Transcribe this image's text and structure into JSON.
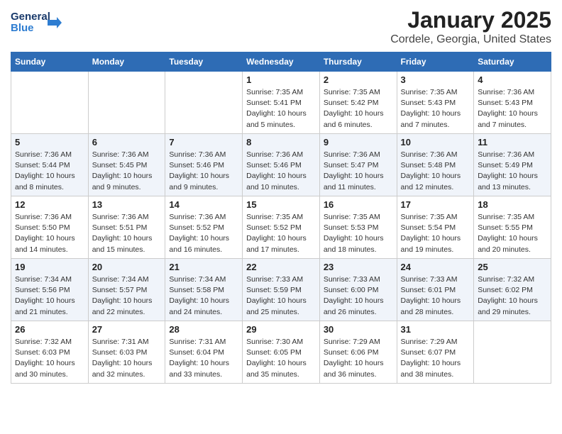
{
  "logo": {
    "line1": "General",
    "line2": "Blue"
  },
  "title": "January 2025",
  "subtitle": "Cordele, Georgia, United States",
  "days_of_week": [
    "Sunday",
    "Monday",
    "Tuesday",
    "Wednesday",
    "Thursday",
    "Friday",
    "Saturday"
  ],
  "weeks": [
    {
      "days": [
        {
          "num": "",
          "info": ""
        },
        {
          "num": "",
          "info": ""
        },
        {
          "num": "",
          "info": ""
        },
        {
          "num": "1",
          "info": "Sunrise: 7:35 AM\nSunset: 5:41 PM\nDaylight: 10 hours\nand 5 minutes."
        },
        {
          "num": "2",
          "info": "Sunrise: 7:35 AM\nSunset: 5:42 PM\nDaylight: 10 hours\nand 6 minutes."
        },
        {
          "num": "3",
          "info": "Sunrise: 7:35 AM\nSunset: 5:43 PM\nDaylight: 10 hours\nand 7 minutes."
        },
        {
          "num": "4",
          "info": "Sunrise: 7:36 AM\nSunset: 5:43 PM\nDaylight: 10 hours\nand 7 minutes."
        }
      ]
    },
    {
      "days": [
        {
          "num": "5",
          "info": "Sunrise: 7:36 AM\nSunset: 5:44 PM\nDaylight: 10 hours\nand 8 minutes."
        },
        {
          "num": "6",
          "info": "Sunrise: 7:36 AM\nSunset: 5:45 PM\nDaylight: 10 hours\nand 9 minutes."
        },
        {
          "num": "7",
          "info": "Sunrise: 7:36 AM\nSunset: 5:46 PM\nDaylight: 10 hours\nand 9 minutes."
        },
        {
          "num": "8",
          "info": "Sunrise: 7:36 AM\nSunset: 5:46 PM\nDaylight: 10 hours\nand 10 minutes."
        },
        {
          "num": "9",
          "info": "Sunrise: 7:36 AM\nSunset: 5:47 PM\nDaylight: 10 hours\nand 11 minutes."
        },
        {
          "num": "10",
          "info": "Sunrise: 7:36 AM\nSunset: 5:48 PM\nDaylight: 10 hours\nand 12 minutes."
        },
        {
          "num": "11",
          "info": "Sunrise: 7:36 AM\nSunset: 5:49 PM\nDaylight: 10 hours\nand 13 minutes."
        }
      ]
    },
    {
      "days": [
        {
          "num": "12",
          "info": "Sunrise: 7:36 AM\nSunset: 5:50 PM\nDaylight: 10 hours\nand 14 minutes."
        },
        {
          "num": "13",
          "info": "Sunrise: 7:36 AM\nSunset: 5:51 PM\nDaylight: 10 hours\nand 15 minutes."
        },
        {
          "num": "14",
          "info": "Sunrise: 7:36 AM\nSunset: 5:52 PM\nDaylight: 10 hours\nand 16 minutes."
        },
        {
          "num": "15",
          "info": "Sunrise: 7:35 AM\nSunset: 5:52 PM\nDaylight: 10 hours\nand 17 minutes."
        },
        {
          "num": "16",
          "info": "Sunrise: 7:35 AM\nSunset: 5:53 PM\nDaylight: 10 hours\nand 18 minutes."
        },
        {
          "num": "17",
          "info": "Sunrise: 7:35 AM\nSunset: 5:54 PM\nDaylight: 10 hours\nand 19 minutes."
        },
        {
          "num": "18",
          "info": "Sunrise: 7:35 AM\nSunset: 5:55 PM\nDaylight: 10 hours\nand 20 minutes."
        }
      ]
    },
    {
      "days": [
        {
          "num": "19",
          "info": "Sunrise: 7:34 AM\nSunset: 5:56 PM\nDaylight: 10 hours\nand 21 minutes."
        },
        {
          "num": "20",
          "info": "Sunrise: 7:34 AM\nSunset: 5:57 PM\nDaylight: 10 hours\nand 22 minutes."
        },
        {
          "num": "21",
          "info": "Sunrise: 7:34 AM\nSunset: 5:58 PM\nDaylight: 10 hours\nand 24 minutes."
        },
        {
          "num": "22",
          "info": "Sunrise: 7:33 AM\nSunset: 5:59 PM\nDaylight: 10 hours\nand 25 minutes."
        },
        {
          "num": "23",
          "info": "Sunrise: 7:33 AM\nSunset: 6:00 PM\nDaylight: 10 hours\nand 26 minutes."
        },
        {
          "num": "24",
          "info": "Sunrise: 7:33 AM\nSunset: 6:01 PM\nDaylight: 10 hours\nand 28 minutes."
        },
        {
          "num": "25",
          "info": "Sunrise: 7:32 AM\nSunset: 6:02 PM\nDaylight: 10 hours\nand 29 minutes."
        }
      ]
    },
    {
      "days": [
        {
          "num": "26",
          "info": "Sunrise: 7:32 AM\nSunset: 6:03 PM\nDaylight: 10 hours\nand 30 minutes."
        },
        {
          "num": "27",
          "info": "Sunrise: 7:31 AM\nSunset: 6:03 PM\nDaylight: 10 hours\nand 32 minutes."
        },
        {
          "num": "28",
          "info": "Sunrise: 7:31 AM\nSunset: 6:04 PM\nDaylight: 10 hours\nand 33 minutes."
        },
        {
          "num": "29",
          "info": "Sunrise: 7:30 AM\nSunset: 6:05 PM\nDaylight: 10 hours\nand 35 minutes."
        },
        {
          "num": "30",
          "info": "Sunrise: 7:29 AM\nSunset: 6:06 PM\nDaylight: 10 hours\nand 36 minutes."
        },
        {
          "num": "31",
          "info": "Sunrise: 7:29 AM\nSunset: 6:07 PM\nDaylight: 10 hours\nand 38 minutes."
        },
        {
          "num": "",
          "info": ""
        }
      ]
    }
  ]
}
